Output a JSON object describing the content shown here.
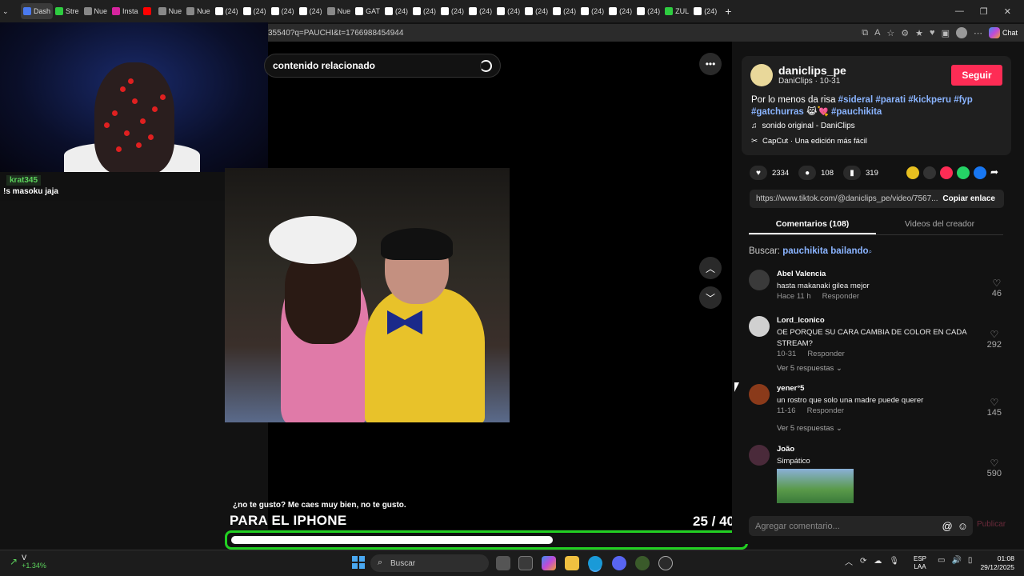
{
  "browser": {
    "tabs": [
      {
        "label": "Dash",
        "color": "#4a7af0",
        "active": true
      },
      {
        "label": "Stre",
        "color": "#2ecc40"
      },
      {
        "label": "Nue",
        "color": "#888888"
      },
      {
        "label": "Insta",
        "color": "#d6249f"
      },
      {
        "label": "",
        "color": "#ff0000"
      },
      {
        "label": "Nue",
        "color": "#888888"
      },
      {
        "label": "Nue",
        "color": "#888888"
      },
      {
        "label": "(24)",
        "color": "#ffffff"
      },
      {
        "label": "(24)",
        "color": "#ffffff"
      },
      {
        "label": "(24)",
        "color": "#ffffff"
      },
      {
        "label": "(24)",
        "color": "#ffffff"
      },
      {
        "label": "Nue",
        "color": "#888888"
      },
      {
        "label": "GAT",
        "color": "#ffffff"
      },
      {
        "label": "(24)",
        "color": "#ffffff"
      },
      {
        "label": "(24)",
        "color": "#ffffff"
      },
      {
        "label": "(24)",
        "color": "#ffffff"
      },
      {
        "label": "(24)",
        "color": "#ffffff"
      },
      {
        "label": "(24)",
        "color": "#ffffff"
      },
      {
        "label": "(24)",
        "color": "#ffffff"
      },
      {
        "label": "(24)",
        "color": "#ffffff"
      },
      {
        "label": "(24)",
        "color": "#ffffff"
      },
      {
        "label": "(24)",
        "color": "#ffffff"
      },
      {
        "label": "(24)",
        "color": "#ffffff"
      },
      {
        "label": "ZUL",
        "color": "#2ecc40"
      },
      {
        "label": "(24)",
        "color": "#ffffff"
      }
    ],
    "url": "35540?q=PAUCHI&t=1766988454944",
    "chat_label": "Chat"
  },
  "stream": {
    "chat_user": "krat345",
    "chat_message": "!s masoku jaja"
  },
  "video": {
    "search_placeholder": "contenido relacionado",
    "caption_small": "¿no te gusto? Me caes muy bien, no te gusto.",
    "caption_big": "PARA EL IPHONE",
    "counter": "25 / 40",
    "progress_fraction": 0.63
  },
  "post": {
    "username": "daniclips_pe",
    "sub": "DaniClips · 10-31",
    "follow_label": "Seguir",
    "desc_text": "Por lo menos da risa",
    "tags": [
      "#sideral",
      "#parati",
      "#kickperu",
      "#fyp",
      "#gatchurras",
      "#pauchikita"
    ],
    "emoji": "😹💘",
    "music": "sonido original - DaniClips",
    "capcut": "CapCut · Una edición más fácil",
    "likes": "2334",
    "comments": "108",
    "saves": "319",
    "link": "https://www.tiktok.com/@daniclips_pe/video/7567...",
    "copy_label": "Copiar enlace",
    "tab_comments": "Comentarios (108)",
    "tab_videos": "Videos del creador",
    "search_prefix": "Buscar:",
    "search_term": "pauchikita bailando"
  },
  "comments": [
    {
      "name": "Abel Valencia",
      "text": "hasta makanaki gilea mejor",
      "time": "Hace 11 h",
      "reply": "Responder",
      "likes": "46",
      "replies": ""
    },
    {
      "name": "Lord_Iconico",
      "text": "OE PORQUE SU CARA CAMBIA DE COLOR EN CADA STREAM?",
      "time": "10-31",
      "reply": "Responder",
      "likes": "292",
      "replies": "Ver 5 respuestas"
    },
    {
      "name": "yener°5",
      "text": "un rostro que solo una madre puede querer",
      "time": "11-16",
      "reply": "Responder",
      "likes": "145",
      "replies": "Ver 5 respuestas"
    },
    {
      "name": "João",
      "text": "Simpático",
      "time": "",
      "reply": "",
      "likes": "590",
      "replies": ""
    }
  ],
  "composer": {
    "placeholder": "Agregar comentario...",
    "publish": "Publicar"
  },
  "taskbar": {
    "stock_symbol": "V",
    "stock_change": "+1.34%",
    "search": "Buscar",
    "lang1": "ESP",
    "lang2": "LAA",
    "time": "01:08",
    "date": "29/12/2025"
  },
  "colors": {
    "accent": "#fe2c55",
    "link": "#8ab4ff",
    "progress": "#22d022"
  }
}
